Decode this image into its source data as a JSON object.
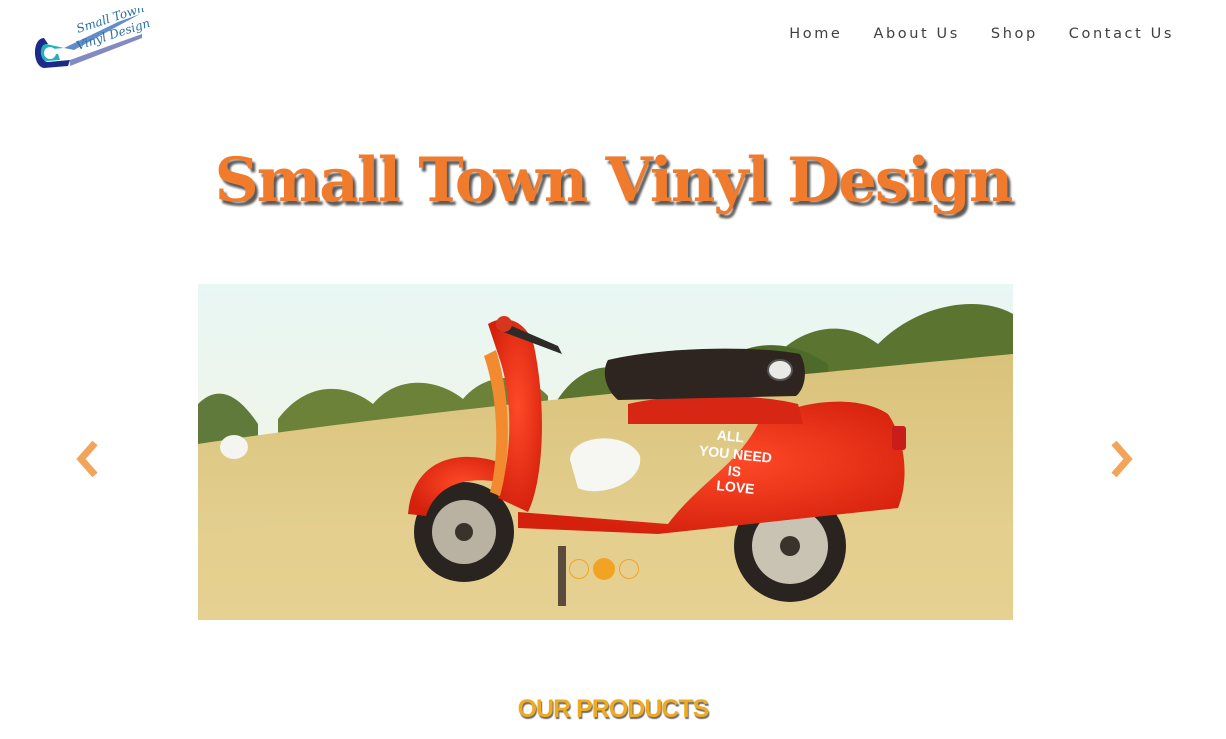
{
  "site": {
    "logo_text": [
      "Small Town",
      "Vinyl Design"
    ],
    "brand_colors": {
      "orange": "#f07b2c",
      "gold": "#efaa21",
      "teal": "#21b3b8",
      "navy": "#1c2a8a"
    }
  },
  "nav": {
    "items": [
      {
        "label": "Home"
      },
      {
        "label": "About Us"
      },
      {
        "label": "Shop"
      },
      {
        "label": "Contact Us"
      }
    ]
  },
  "hero": {
    "title": "Small Town Vinyl Design"
  },
  "carousel": {
    "decal_text": [
      "ALL",
      "YOU NEED",
      "IS",
      "LOVE"
    ],
    "slides_count": 3,
    "active_index": 1,
    "prev_icon": "chevron-left-icon",
    "next_icon": "chevron-right-icon"
  },
  "products": {
    "heading": "OUR PRODUCTS"
  }
}
